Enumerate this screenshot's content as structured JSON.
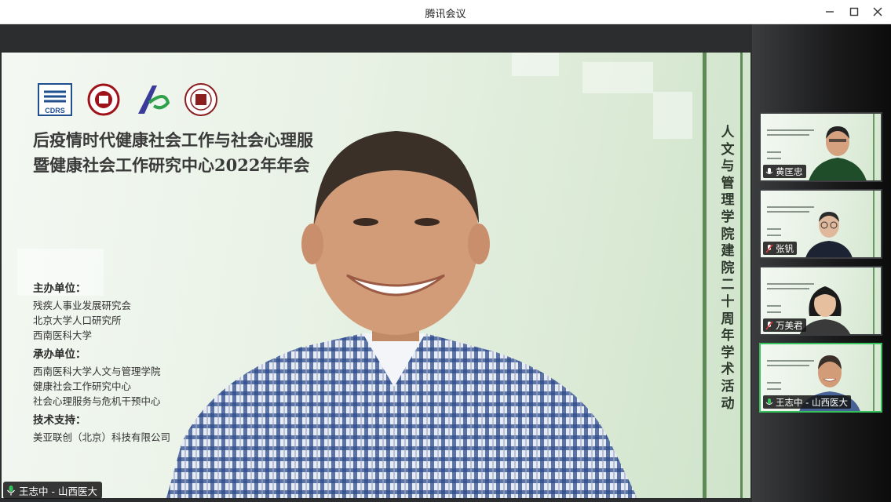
{
  "window": {
    "title": "腾讯会议"
  },
  "slide": {
    "logos": [
      "cdrs-logo",
      "peking-university-logo",
      "lr-logo",
      "medical-university-logo"
    ],
    "logo_cdrs_text": "CDRS",
    "title_line1": "后疫情时代健康社会工作与社会心理服",
    "title_line2": "暨健康社会工作研究中心2022年年会",
    "host": {
      "heading": "主办单位：",
      "items": [
        "残疾人事业发展研究会",
        "北京大学人口研究所",
        "西南医科大学"
      ]
    },
    "organizer": {
      "heading": "承办单位：",
      "items": [
        "西南医科大学人文与管理学院",
        "健康社会工作研究中心",
        "社会心理服务与危机干预中心"
      ]
    },
    "tech": {
      "heading": "技术支持：",
      "items": [
        "美亚联创（北京）科技有限公司"
      ]
    },
    "vertical_text": "人文与管理学院建院二十周年学术活动",
    "accent": "#5d8a55"
  },
  "main_speaker": {
    "name": "王志中 - 山西医大",
    "mic": "mic-on"
  },
  "participants": [
    {
      "name": "黄匡忠",
      "mic": "mic-on",
      "active": false
    },
    {
      "name": "张钒",
      "mic": "mic-muted",
      "active": false
    },
    {
      "name": "万美君",
      "mic": "mic-muted",
      "active": false
    },
    {
      "name": "王志中 - 山西医大",
      "mic": "mic-on",
      "active": true
    }
  ],
  "colors": {
    "active_border": "#35c25c",
    "muted": "#e03a3a",
    "mic_on": "#35c25c"
  }
}
